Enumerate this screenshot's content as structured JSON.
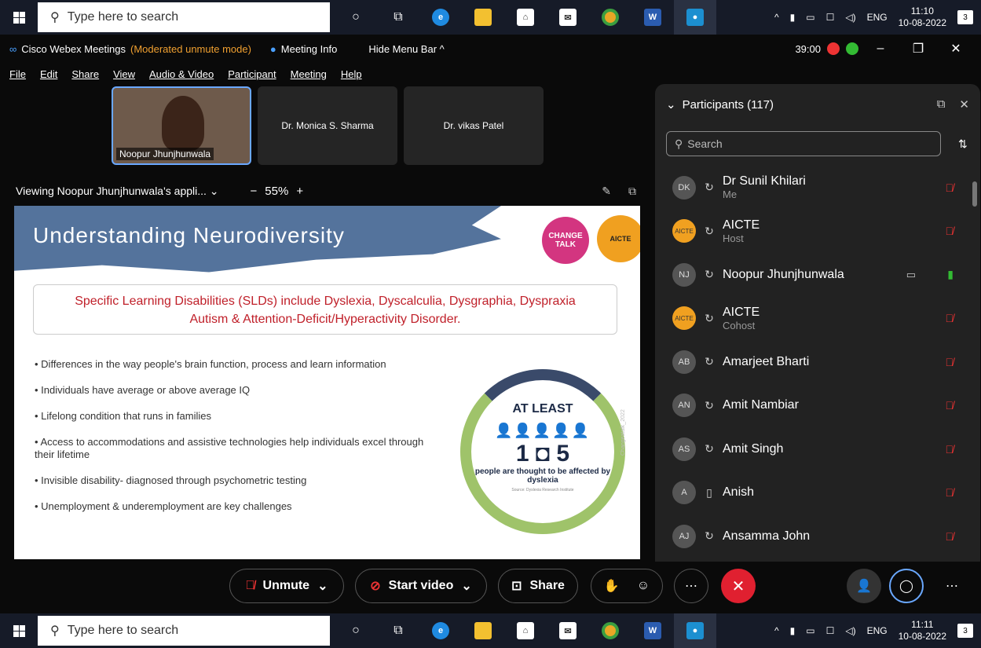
{
  "taskbar": {
    "search_placeholder": "Type here to search",
    "lang": "ENG",
    "time_top": "11:10",
    "date_top": "10-08-2022",
    "time_bot": "11:11",
    "date_bot": "10-08-2022",
    "notif_count": "3"
  },
  "window": {
    "app_title": "Cisco Webex Meetings",
    "mode": "(Moderated unmute mode)",
    "meeting_info": "Meeting Info",
    "hide_menu": "Hide Menu Bar ^",
    "timer": "39:00"
  },
  "menu": [
    "File",
    "Edit",
    "Share",
    "View",
    "Audio & Video",
    "Participant",
    "Meeting",
    "Help"
  ],
  "thumbnails": [
    {
      "name": "Noopur Jhunjhunwala"
    },
    {
      "name": "Dr. Monica S. Sharma"
    },
    {
      "name": "Dr. vikas Patel"
    }
  ],
  "viewing": {
    "label": "Viewing Noopur Jhunjhunwala's appli...",
    "zoom": "55%"
  },
  "slide": {
    "title": "Understanding Neurodiversity",
    "logo1": "CHANGE TALK",
    "logo2": "AICTE",
    "sld_line1": "Specific Learning Disabilities (SLDs) include Dyslexia, Dyscalculia, Dysgraphia, Dyspraxia",
    "sld_line2": "Autism & Attention-Deficit/Hyperactivity Disorder.",
    "bullets": [
      "Differences in the way people's brain function, process and learn information",
      "Individuals have average or above average IQ",
      "Lifelong condition that runs in families",
      "Access to accommodations and assistive technologies help individuals excel through their lifetime",
      "Invisible disability- diagnosed through psychometric testing",
      "Unemployment & underemployment are key challenges"
    ],
    "circle_top": "AT LEAST",
    "circle_num": "1 ◘ 5",
    "circle_text": "people are thought to be affected by dyslexia",
    "circle_src": "Source: Dyslexia Research Institute",
    "watermark": "Changeatalk_2022"
  },
  "participants": {
    "title": "Participants (117)",
    "search_placeholder": "Search",
    "list": [
      {
        "initials": "DK",
        "name": "Dr Sunil Khilari",
        "role": "Me"
      },
      {
        "initials": "AICTE",
        "name": "AICTE",
        "role": "Host"
      },
      {
        "initials": "NJ",
        "name": "Noopur Jhunjhunwala",
        "role": ""
      },
      {
        "initials": "AICTE",
        "name": "AICTE",
        "role": "Cohost"
      },
      {
        "initials": "AB",
        "name": "Amarjeet Bharti",
        "role": ""
      },
      {
        "initials": "AN",
        "name": "Amit Nambiar",
        "role": ""
      },
      {
        "initials": "AS",
        "name": "Amit Singh",
        "role": ""
      },
      {
        "initials": "A",
        "name": "Anish",
        "role": ""
      },
      {
        "initials": "AJ",
        "name": "Ansamma John",
        "role": ""
      }
    ]
  },
  "controls": {
    "unmute": "Unmute",
    "start_video": "Start video",
    "share": "Share"
  }
}
